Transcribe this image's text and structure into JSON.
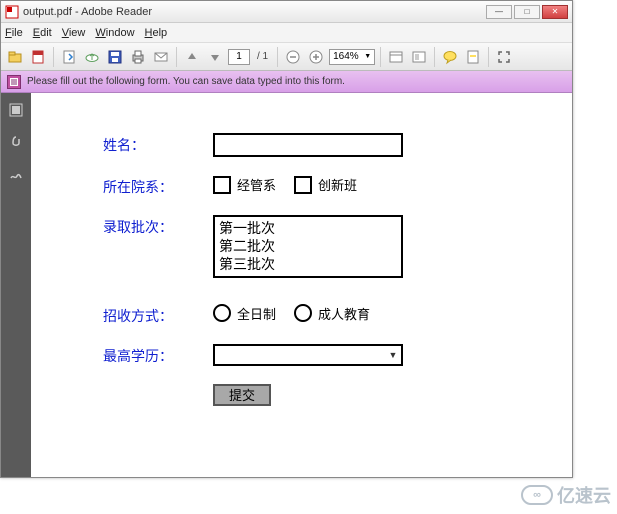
{
  "window": {
    "title": "output.pdf - Adobe Reader"
  },
  "menu": {
    "file": "File",
    "edit": "Edit",
    "view": "View",
    "window": "Window",
    "help": "Help"
  },
  "toolbar": {
    "page_current": "1",
    "page_total": "/ 1",
    "zoom": "164%"
  },
  "banner": {
    "message": "Please fill out the following form. You can save data typed into this form."
  },
  "form": {
    "name_label": "姓名：",
    "dept_label": "所在院系：",
    "dept_opt1": "经管系",
    "dept_opt2": "创新班",
    "batch_label": "录取批次：",
    "batch_items": {
      "0": "第一批次",
      "1": "第二批次",
      "2": "第三批次"
    },
    "mode_label": "招收方式：",
    "mode_opt1": "全日制",
    "mode_opt2": "成人教育",
    "edu_label": "最高学历：",
    "submit": "提交"
  },
  "watermark": "亿速云"
}
